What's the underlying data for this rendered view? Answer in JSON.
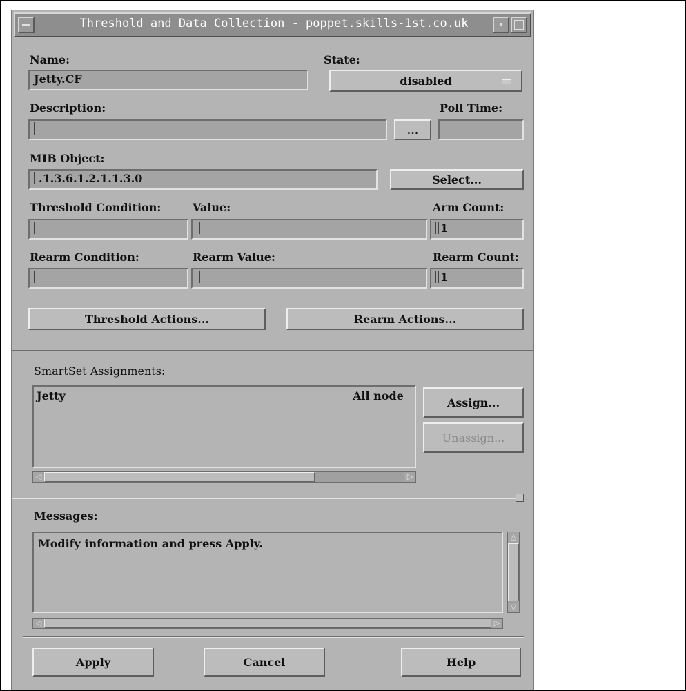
{
  "window": {
    "title": "Threshold and Data Collection - poppet.skills-1st.co.uk"
  },
  "form": {
    "name_label": "Name:",
    "name_value": "Jetty.CF",
    "state_label": "State:",
    "state_value": "disabled",
    "description_label": "Description:",
    "description_value": "",
    "ellipsis_button": "...",
    "poll_time_label": "Poll Time:",
    "poll_time_value": "",
    "mib_object_label": "MIB Object:",
    "mib_object_value": ".1.3.6.1.2.1.1.3.0",
    "select_button": "Select...",
    "threshold_condition_label": "Threshold Condition:",
    "value_label": "Value:",
    "arm_count_label": "Arm Count:",
    "threshold_condition_value": "",
    "value_value": "",
    "arm_count_value": "1",
    "rearm_condition_label": "Rearm Condition:",
    "rearm_value_label": "Rearm Value:",
    "rearm_count_label": "Rearm Count:",
    "rearm_condition_value": "",
    "rearm_value_value": "",
    "rearm_count_value": "1",
    "threshold_actions_button": "Threshold Actions...",
    "rearm_actions_button": "Rearm Actions..."
  },
  "smartset": {
    "label": "SmartSet Assignments:",
    "items": [
      {
        "name": "Jetty",
        "scope": "All node"
      }
    ],
    "assign_button": "Assign...",
    "unassign_button": "Unassign..."
  },
  "messages": {
    "label": "Messages:",
    "text": "Modify information and press Apply."
  },
  "footer": {
    "apply_button": "Apply",
    "cancel_button": "Cancel",
    "help_button": "Help"
  }
}
